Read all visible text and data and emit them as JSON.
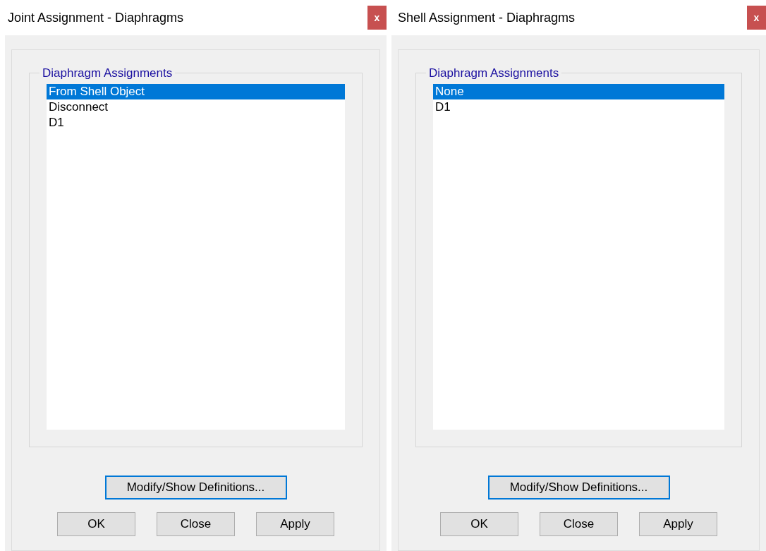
{
  "dialogs": [
    {
      "title": "Joint Assignment - Diaphragms",
      "close": "x",
      "group_label": "Diaphragm Assignments",
      "items": [
        {
          "label": "From Shell Object",
          "selected": true
        },
        {
          "label": "Disconnect",
          "selected": false
        },
        {
          "label": "D1",
          "selected": false
        }
      ],
      "definitions_button": "Modify/Show Definitions...",
      "buttons": [
        "OK",
        "Close",
        "Apply"
      ]
    },
    {
      "title": "Shell Assignment - Diaphragms",
      "close": "x",
      "group_label": "Diaphragm Assignments",
      "items": [
        {
          "label": "None",
          "selected": true
        },
        {
          "label": "D1",
          "selected": false
        }
      ],
      "definitions_button": "Modify/Show Definitions...",
      "buttons": [
        "OK",
        "Close",
        "Apply"
      ]
    }
  ]
}
